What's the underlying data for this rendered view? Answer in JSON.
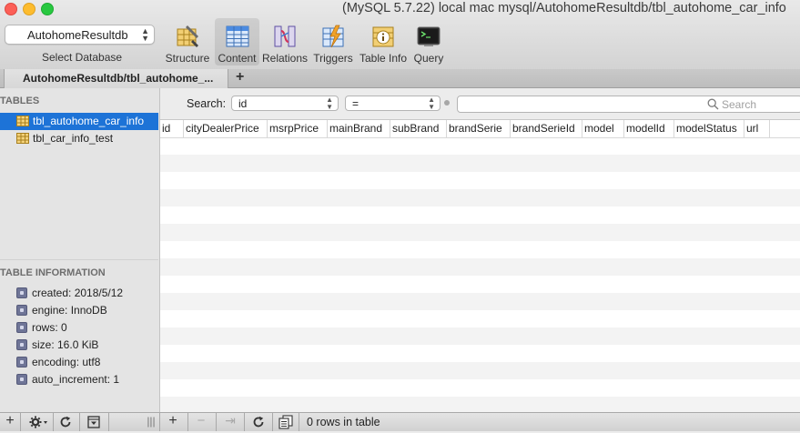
{
  "window": {
    "title": "(MySQL 5.7.22) local mac mysql/AutohomeResultdb/tbl_autohome_car_info"
  },
  "toolbar": {
    "database_value": "AutohomeResultdb",
    "database_label": "Select Database",
    "items": [
      {
        "label": "Structure",
        "icon": "structure-icon"
      },
      {
        "label": "Content",
        "icon": "content-icon",
        "active": true
      },
      {
        "label": "Relations",
        "icon": "relations-icon"
      },
      {
        "label": "Triggers",
        "icon": "triggers-icon"
      },
      {
        "label": "Table Info",
        "icon": "table-info-icon"
      },
      {
        "label": "Query",
        "icon": "query-icon"
      }
    ]
  },
  "tabs": {
    "active_label": "AutohomeResultdb/tbl_autohome_...",
    "add_label": "+"
  },
  "sidebar": {
    "tables_heading": "TABLES",
    "tables": [
      {
        "name": "tbl_autohome_car_info",
        "selected": true
      },
      {
        "name": "tbl_car_info_test",
        "selected": false
      }
    ],
    "info_heading": "TABLE INFORMATION",
    "info": [
      "created: 2018/5/12",
      "engine: InnoDB",
      "rows: 0",
      "size: 16.0 KiB",
      "encoding: utf8",
      "auto_increment: 1"
    ]
  },
  "filter": {
    "label": "Search:",
    "field_value": "id",
    "operator_value": "=",
    "search_placeholder": "Search"
  },
  "grid": {
    "columns": [
      "id",
      "cityDealerPrice",
      "msrpPrice",
      "mainBrand",
      "subBrand",
      "brandSerie",
      "brandSerieId",
      "model",
      "modelId",
      "modelStatus",
      "url"
    ]
  },
  "footer": {
    "add_label": "+",
    "remove_label": "−",
    "duplicate_label": "⇥",
    "status": "0 rows in table"
  },
  "colors": {
    "selection": "#1d73d7",
    "close": "#fc5f57",
    "minimize": "#fdbc2e",
    "zoom": "#28c840"
  }
}
